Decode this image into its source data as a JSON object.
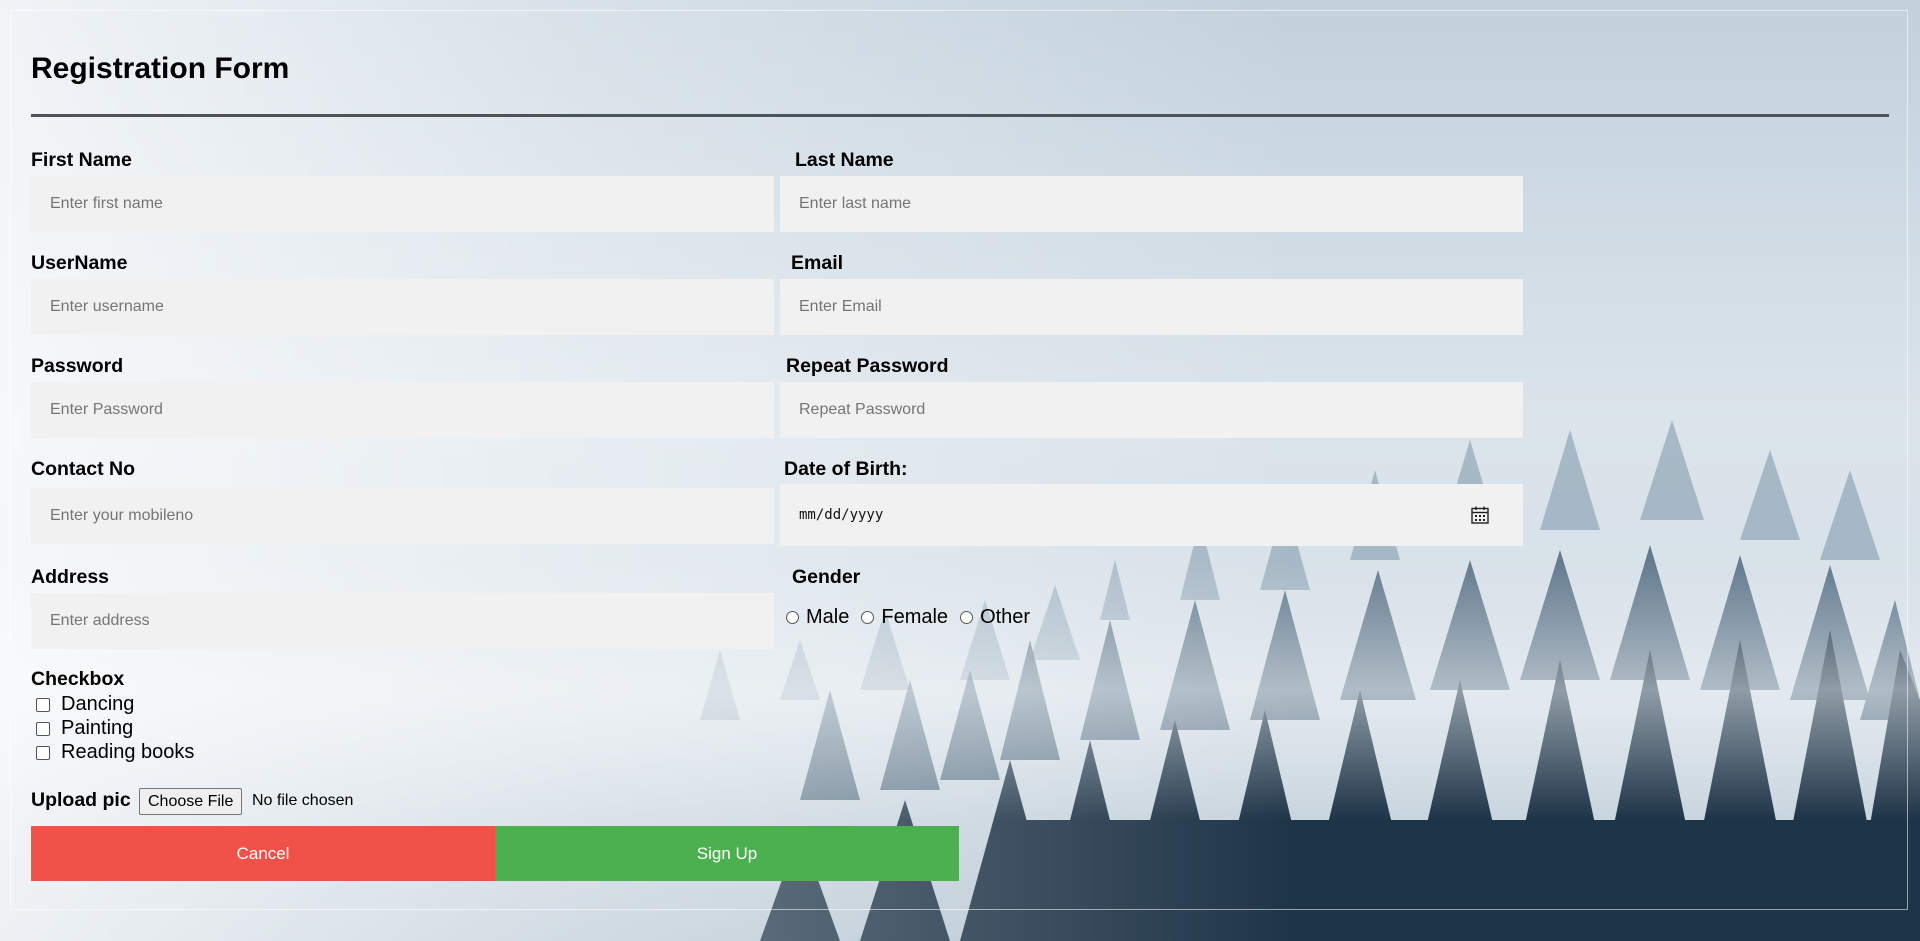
{
  "form": {
    "title": "Registration Form",
    "fields": {
      "first_name": {
        "label": "First Name",
        "placeholder": "Enter first name"
      },
      "last_name": {
        "label": "Last Name",
        "placeholder": "Enter last name"
      },
      "username": {
        "label": "UserName",
        "placeholder": "Enter username"
      },
      "email": {
        "label": "Email",
        "placeholder": "Enter Email"
      },
      "password": {
        "label": "Password",
        "placeholder": "Enter Password"
      },
      "repeat_password": {
        "label": "Repeat Password",
        "placeholder": "Repeat Password"
      },
      "contact": {
        "label": "Contact No",
        "placeholder": "Enter your mobileno"
      },
      "dob": {
        "label": "Date of Birth:",
        "placeholder": "mm/dd/yyyy",
        "icon": "calendar-icon"
      },
      "address": {
        "label": "Address",
        "placeholder": "Enter address"
      }
    },
    "gender": {
      "label": "Gender",
      "options": [
        "Male",
        "Female",
        "Other"
      ]
    },
    "checkbox": {
      "label": "Checkbox",
      "options": [
        "Dancing",
        "Painting",
        "Reading books"
      ]
    },
    "upload": {
      "label": "Upload pic",
      "button_label": "Choose File",
      "status": "No file chosen"
    },
    "buttons": {
      "cancel": "Cancel",
      "signup": "Sign Up"
    },
    "colors": {
      "cancel": "#f0524a",
      "signup": "#4caf50",
      "input_bg": "#f1f1f1"
    }
  }
}
